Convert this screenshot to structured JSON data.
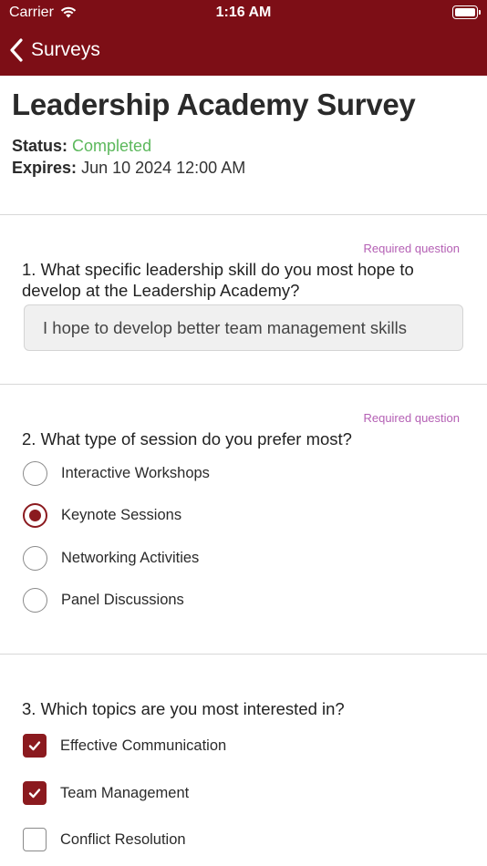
{
  "status_bar": {
    "carrier": "Carrier",
    "time": "1:16 AM",
    "wifi_icon": "wifi-icon",
    "battery_icon": "battery-icon"
  },
  "nav": {
    "back_label": "Surveys",
    "back_icon": "chevron-left-icon",
    "background_color": "#7d0e16"
  },
  "survey": {
    "title": "Leadership Academy Survey",
    "status_label": "Status:",
    "status_value": "Completed",
    "status_color": "#5cb85c",
    "expires_label": "Expires:",
    "expires_value": "Jun 10 2024 12:00 AM"
  },
  "questions": [
    {
      "required_label": "Required question",
      "text": "1. What specific leadership skill do you most hope to develop at the Leadership Academy?",
      "answer": "I hope to develop better team management skills"
    },
    {
      "required_label": "Required question",
      "text": "2. What type of session do you prefer most?",
      "options": [
        {
          "label": "Interactive Workshops",
          "selected": false
        },
        {
          "label": "Keynote Sessions",
          "selected": true
        },
        {
          "label": "Networking Activities",
          "selected": false
        },
        {
          "label": "Panel Discussions",
          "selected": false
        }
      ]
    },
    {
      "text": "3. Which topics are you most interested in?",
      "options": [
        {
          "label": "Effective Communication",
          "checked": true
        },
        {
          "label": "Team Management",
          "checked": true
        },
        {
          "label": "Conflict Resolution",
          "checked": false
        }
      ]
    }
  ],
  "accent_color": "#8b1a1f"
}
